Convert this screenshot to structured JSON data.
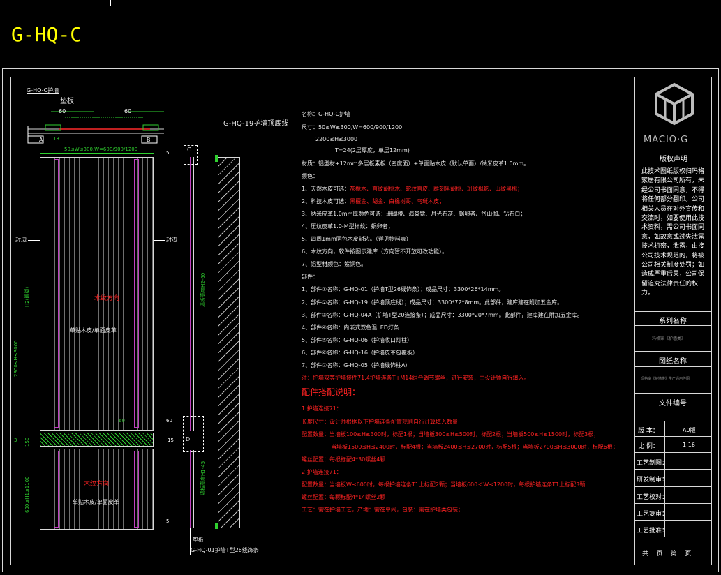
{
  "header": {
    "code": "G-HQ-C"
  },
  "drawing": {
    "section_title": "G-HQ-C护墙",
    "pad_label": "垫板",
    "dim_60a": "60",
    "dim_60b": "60",
    "dim_13": "13",
    "front_dim_top": "50≤W≤300,W=600/900/1200",
    "front_dim_height": "2300≤H≤3000",
    "front_dim_lower": "600≤H1≤1100",
    "front_dim_mid": "H2(踢脚)",
    "front_dim_3": "3",
    "front_dim_150": "150",
    "front_dim_5a": "5",
    "front_dim_5b": "5",
    "edge_left": "封边",
    "edge_right": "封边",
    "grain_dir_upper": "木纹方向",
    "grain_dir_lower": "木纹方向",
    "veneer_upper": "单贴木皮/单面皮革",
    "veneer_lower": "单贴木皮/单面皮革",
    "section_letter_a": "A",
    "section_letter_b": "B",
    "section_letter_c": "C",
    "section_letter_d": "D",
    "side_height_upper": "墙板高度H2-60",
    "side_height_lower": "墙板高度H1-45",
    "callout_top": "G-HQ-19护墙顶底线",
    "callout_bottom_pad": "垫板",
    "callout_bottom": "G-HQ-01护墙T型26线饰条",
    "dim_60c": "60",
    "dim_60d": "60",
    "dim_15": "15"
  },
  "spec": {
    "name": "名称：G-HQ-C护墙",
    "size": "尺寸：50≤W≤300,W=600/900/1200",
    "size2": "2200≤H≤3000",
    "thickness": "T=24(2层厚度，单层12mm)",
    "material": "材质：铝型材+12mm多层板素板（密度面）+单面贴木皮（默认单面）/纳米皮革1.0mm。",
    "color_title": "颜色：",
    "c1_label": "1、天然木皮可选：",
    "c1_value": "灰橡木、直纹胡桃木、蛇纹直皮、雕刻黑胡桃、斑纹枫影、山纹黑桃；",
    "c2_label": "2、科技木皮可选：",
    "c2_value": "黑檀金、胡金、白橡树哥、乌斑木皮；",
    "c3": "3、纳米皮革1.0mm厚颜色可选：珊瑚橙、海棠紫、月光石灰、蜗卵者、岱山伽、钻石白；",
    "c4": "4、压纹皮革1.0-M型样纹：蜗卵者；",
    "c5": "5、四周1mm同色木皮封边。（详见物料表）",
    "c6": "6、木纹方向，软件按图示建库（方向暂不开放可改功能）。",
    "c7": "7、铝型材颜色：紫铜色。",
    "parts_title": "部件：",
    "p1": "1、部件①名称：G-HQ-01（护墙T型26线饰条）；成品尺寸：3300*26*14mm。",
    "p2": "2、部件②名称：G-HQ-19（护墙顶底线）；成品尺寸：3300*72*8mm。此部件，建库建在附加五金库。",
    "p3": "3、部件③名称：G-HQ-04A（护墙T型20连接条）；成品尺寸：3300*20*7mm。此部件，建库建在附加五金库。",
    "p4": "4、部件④名称：内嵌式双色温LED灯条",
    "p5": "5、部件⑤名称：G-HQ-06（护墙收口灯柱）",
    "p6": "6、部件⑥名称：G-HQ-16（护墙皮革包覆板）",
    "p7": "7、部件⑦名称：G-HQ-05（护墙线饰柱A）",
    "note": "注：护墙双等护墙接件71.4护墙连条T+M14组合调节螺丝，进行安装，由设计师自行填入。",
    "accessory_title": "配件搭配说明：",
    "a1": "1.护墙连接71：",
    "a2": "长度尺寸：设计师根据以下护墙连条配置规则自行计算填入数量",
    "a3": "配置数量：当墙板100≤H≤300时，标配1根；当墙板300≤H≤500时，标配2根；当墙板500≤H≤1500时，标配3根；",
    "a4": "当墙板1500≤H≤2400时，标配4根；当墙板2400≤H≤2700时，标配5根；当墙板2700≤H≤3000时，标配6根；",
    "a5": "螺丝配置：每根标配4*30螺丝4颗",
    "a6": "2.护墙连接71：",
    "a7": "配置数量：当墙板W≤600时，每根护墙连条T1上标配2颗；当墙板600＜W≤1200时，每根护墙连条T1上标配3颗",
    "a8": "螺丝配置：每颗标配4*14螺丝2颗",
    "a9": "工艺：需在护墙工艺，产地：需在单间，包装：需在护墙类包装；"
  },
  "titleblock": {
    "logo_text": "MACIO·G",
    "copyright_title": "版权声明",
    "copyright_body": "此技术图纸版权归玛格家居有限公司所有，未经公司书面同意，不得将任何部分翻印。公司相关人员在对外宣传和交流时，如要使用此技术资料，需公司书面同意，如故意或过失泄露技术机密，泄露，由接公司技术规范的，将被公司相关制度处罚；如造成严重后果，公司保留追究法律责任的权力。",
    "series_label": "系列名称",
    "series_value": "玛格家《护墙类》",
    "drawing_name_label": "图纸名称",
    "drawing_name_value": "玛格家《护墙类》生产通用件图",
    "file_no_label": "文件编号",
    "version_label": "版  本：",
    "version_value": "A0版",
    "scale_label": "比  例：",
    "scale_value": "1:16",
    "draw_label": "工艺制图：",
    "rd_label": "研发制审：",
    "check_label": "工艺校对：",
    "review_label": "工艺复审：",
    "approve_label": "工艺批准：",
    "pages": "共    页    第    页"
  },
  "colors": {
    "frame": "#d8d8d8",
    "purple": "#c040c0",
    "green": "#2fd02f",
    "red": "#ff2222",
    "yellow": "#ffff00",
    "grain": "#8a8a8a"
  }
}
